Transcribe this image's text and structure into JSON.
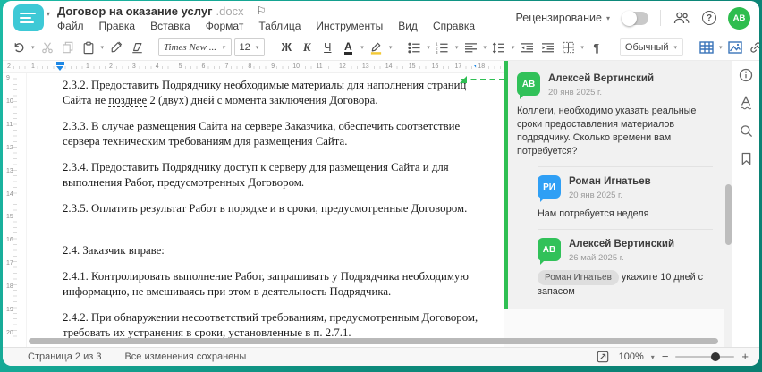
{
  "header": {
    "title": "Договор на оказание услуг",
    "ext": ".docx",
    "menu": [
      "Файл",
      "Правка",
      "Вставка",
      "Формат",
      "Таблица",
      "Инструменты",
      "Вид",
      "Справка"
    ],
    "review": "Рецензирование",
    "avatar_initials": "АВ"
  },
  "toolbar": {
    "font": "Times New ...",
    "size": "12",
    "bold": "Ж",
    "italic": "К",
    "underline": "Ч",
    "font_color_letter": "А",
    "style": "Обычный",
    "pilcrow": "¶",
    "more": "···"
  },
  "ruler": {
    "h_numbers": [
      "2",
      "1",
      "1",
      "2",
      "3",
      "4",
      "5",
      "6",
      "7",
      "8",
      "9",
      "10",
      "11",
      "12",
      "13",
      "14",
      "15",
      "16",
      "17",
      "18"
    ],
    "v_numbers": [
      "9",
      "10",
      "11",
      "12",
      "13",
      "14",
      "15",
      "16",
      "17",
      "18",
      "19",
      "20"
    ]
  },
  "document": {
    "paragraphs": [
      {
        "segments": [
          {
            "text": "2.3.2. Предоставить Подрядчику необходимые материалы для наполнения страниц Сайта не "
          },
          {
            "text": "позднее",
            "mark": "comment"
          },
          {
            "text": " 2 (двух) дней с момента заключения Договора."
          }
        ]
      },
      {
        "segments": [
          {
            "text": "2.3.3. В случае размещения Сайта на сервере Заказчика, обеспечить соответствие сервера техническим требованиям для размещения Сайта."
          }
        ]
      },
      {
        "segments": [
          {
            "text": "2.3.4. Предоставить Подрядчику доступ к серверу для размещения Сайта и для выполнения Работ, предусмотренных Договором."
          }
        ]
      },
      {
        "segments": [
          {
            "text": "2.3.5. Оплатить результат Работ в порядке и в сроки, предусмотренные Договором."
          }
        ]
      },
      {
        "gap_before": true,
        "segments": [
          {
            "text": "2.4. Заказчик вправе:"
          }
        ]
      },
      {
        "segments": [
          {
            "text": "2.4.1. Контролировать выполнение Работ, запрашивать у Подрядчика необходимую информацию, не вмешиваясь при этом в деятельность Подрядчика."
          }
        ]
      },
      {
        "segments": [
          {
            "text": "2.4.2. При обнаружении несоответствий требованиям, предусмотренным Договором, требовать их устранения в сроки, установленные "
          },
          {
            "text": "в",
            "mark": "grammar"
          },
          {
            "text": " п. 2.7.1."
          }
        ]
      }
    ]
  },
  "comments": [
    {
      "initials": "АВ",
      "color": "green",
      "name": "Алексей Вертинский",
      "date": "20 янв 2025 г.",
      "text": "Коллеги, необходимо указать реальные сроки предоставления материалов подрядчику. Сколько времени вам потребуется?",
      "reply": false
    },
    {
      "initials": "РИ",
      "color": "blue",
      "name": "Роман Игнатьев",
      "date": "20 янв 2025 г.",
      "text": "Нам потребуется неделя",
      "reply": true
    },
    {
      "initials": "АВ",
      "color": "green",
      "name": "Алексей Вертинский",
      "date": "26 май 2025 г.",
      "mention": "Роман Игнатьев",
      "text": "укажите 10 дней с запасом",
      "reply": true
    }
  ],
  "statusbar": {
    "page": "Страница 2 из 3",
    "saved": "Все изменения сохранены",
    "zoom": "100%",
    "minus": "−",
    "plus": "+"
  },
  "colors": {
    "frame_teal": "#0d8a7b",
    "logo_teal": "#3ec9d6",
    "accent_green": "#2fbf53",
    "avatar_green": "#31c159",
    "avatar_blue": "#2f9ff5",
    "toolbar_blue": "#3a74ba",
    "ruler_marker_blue": "#1e88e5"
  }
}
